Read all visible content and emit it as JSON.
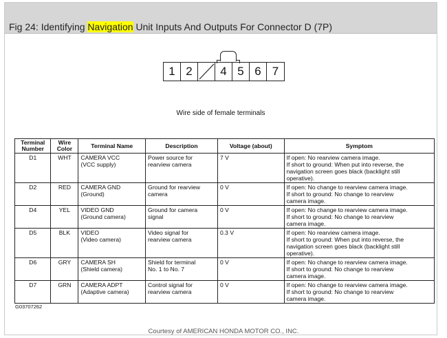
{
  "figure": {
    "title_prefix": "Fig 24: Identifying ",
    "title_highlight": "Navigation",
    "title_suffix": " Unit Inputs And Outputs For Connector D (7P)",
    "connector_pins": [
      "1",
      "2",
      "",
      "4",
      "5",
      "6",
      "7"
    ],
    "caption": "Wire side of female terminals",
    "code": "G03707262",
    "courtesy": "Courtesy of AMERICAN HONDA MOTOR CO., INC."
  },
  "table": {
    "headers": [
      "Terminal\nNumber",
      "Wire\nColor",
      "Terminal Name",
      "Description",
      "Voltage (about)",
      "Symptom"
    ],
    "rows": [
      [
        "D1",
        "WHT",
        "CAMERA VCC\n(VCC supply)",
        "Power source for\nrearview camera",
        "7 V",
        "If open: No rearview camera image.\nIf short to ground: When put into reverse, the\nnavigation screen goes black (backlight still\noperative)."
      ],
      [
        "D2",
        "RED",
        "CAMERA GND\n(Ground)",
        "Ground for rearview\ncamera",
        "0 V",
        "If open: No change to rearview camera image.\nIf short to ground: No change to rearview\ncamera image."
      ],
      [
        "D4",
        "YEL",
        "VIDEO GND\n(Ground camera)",
        "Ground for camera\nsignal",
        "0 V",
        "If open: No change to rearview camera image.\nIf short to ground: No change to rearview\ncamera image."
      ],
      [
        "D5",
        "BLK",
        "VIDEO\n(Video camera)",
        "Video signal for\nrearview camera",
        "0.3 V",
        "If open: No rearview camera image.\nIf short to ground: When put into reverse, the\nnavigation screen goes black (backlight still\noperative)."
      ],
      [
        "D6",
        "GRY",
        "CAMERA SH\n(Shield camera)",
        "Shield for terminal\nNo. 1 to No. 7",
        "0 V",
        "If open: No change to rearview camera image.\nIf short to ground: No change to rearview\ncamera image."
      ],
      [
        "D7",
        "GRN",
        "CAMERA ADPT\n(Adaptive camera)",
        "Control signal for\nrearview camera",
        "0 V",
        "If open: No change to rearview camera image.\nIf short to ground: No change to rearview\ncamera image."
      ]
    ]
  }
}
